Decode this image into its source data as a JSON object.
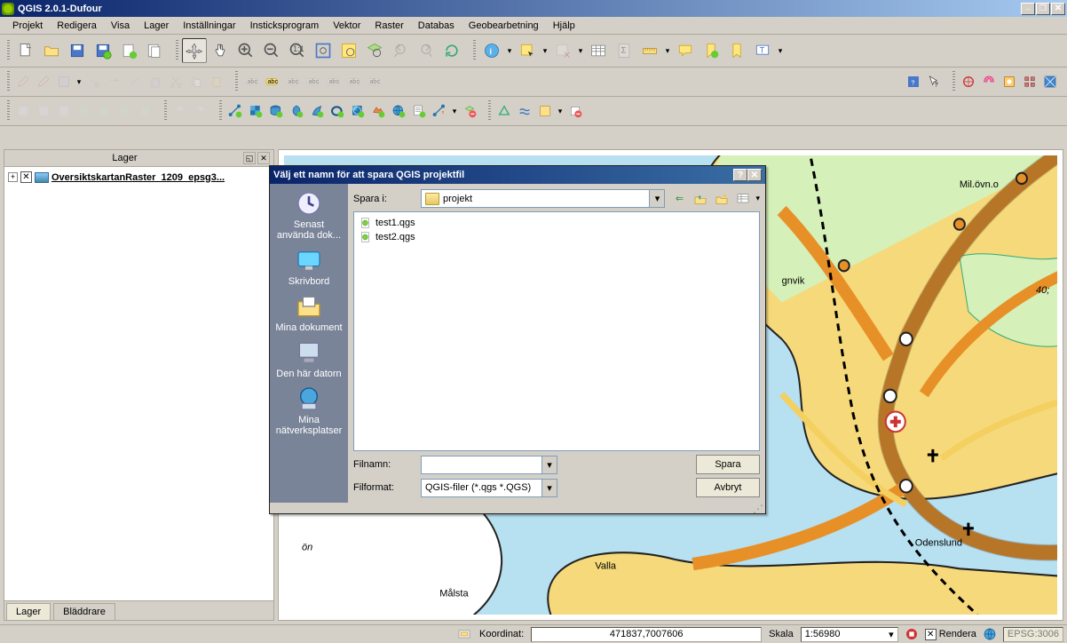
{
  "window": {
    "title": "QGIS 2.0.1-Dufour"
  },
  "menus": [
    "Projekt",
    "Redigera",
    "Visa",
    "Lager",
    "Inställningar",
    "Insticksprogram",
    "Vektor",
    "Raster",
    "Databas",
    "Geobearbetning",
    "Hjälp"
  ],
  "layers_panel": {
    "title": "Lager",
    "layer": "OversiktskartanRaster_1209_epsg3...",
    "layer_checked": "✕",
    "tabs": [
      "Lager",
      "Bläddrare"
    ]
  },
  "save_dialog": {
    "title": "Välj ett namn för att spara QGIS projektfil",
    "look_in_label": "Spara i:",
    "look_in_value": "projekt",
    "places": [
      {
        "label": "Senast\nanvända dok...",
        "icon": "recent"
      },
      {
        "label": "Skrivbord",
        "icon": "desktop"
      },
      {
        "label": "Mina dokument",
        "icon": "mydocs"
      },
      {
        "label": "Den här datorn",
        "icon": "computer"
      },
      {
        "label": "Mina\nnätverksplatser",
        "icon": "network"
      }
    ],
    "files": [
      "test1.qgs",
      "test2.qgs"
    ],
    "filename_label": "Filnamn:",
    "filename_value": "",
    "fileformat_label": "Filformat:",
    "fileformat_value": "QGIS-filer (*.qgs *.QGS)",
    "save_btn": "Spara",
    "cancel_btn": "Avbryt"
  },
  "statusbar": {
    "coord_label": "Koordinat:",
    "coord_value": "471837,7007606",
    "scale_label": "Skala",
    "scale_value": "1:56980",
    "render_label": "Rendera",
    "crs_value": "EPSG:3006"
  },
  "map_labels": {
    "l1": "Mil.övn.o",
    "l2": "gnvik",
    "l3": "40;",
    "l4": "Odenslund",
    "l5": "Valla",
    "l6": "Målsta",
    "l7": "ön"
  }
}
